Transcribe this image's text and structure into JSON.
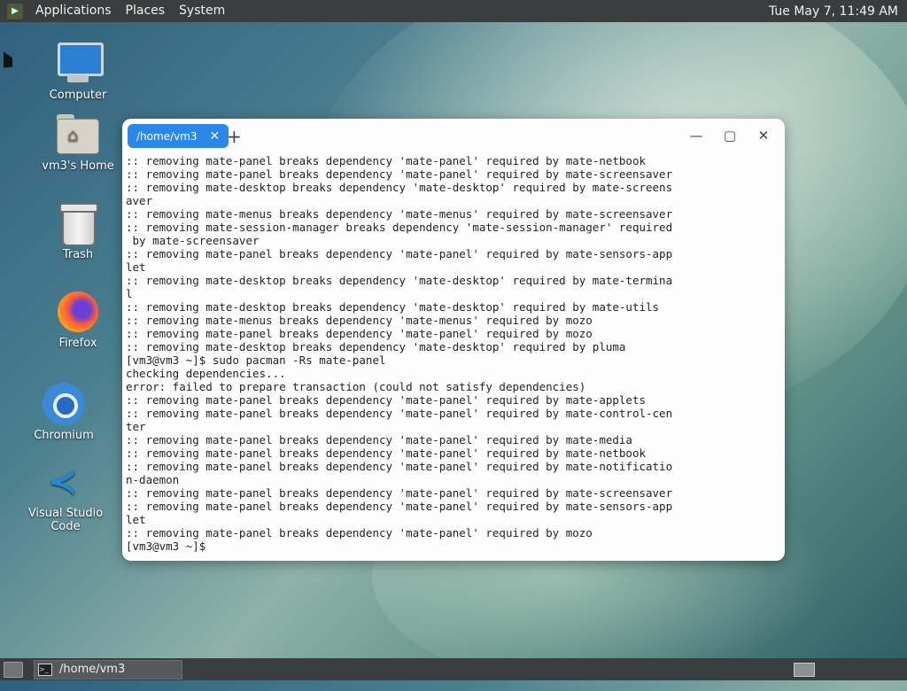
{
  "top_panel": {
    "menus": [
      "Applications",
      "Places",
      "System"
    ],
    "clock": "Tue May 7, 11:49 AM"
  },
  "desktop_icons": [
    {
      "label": "Computer",
      "icon": "computer-icon"
    },
    {
      "label": "vm3's Home",
      "icon": "home-folder-icon"
    },
    {
      "label": "Trash",
      "icon": "trash-icon"
    },
    {
      "label": "Firefox",
      "icon": "firefox-icon"
    },
    {
      "label": "Chromium",
      "icon": "chromium-icon"
    },
    {
      "label": "Visual Studio Code",
      "icon": "vscode-icon"
    }
  ],
  "terminal": {
    "tab_title": "/home/vm3",
    "lines": [
      ":: removing mate-panel breaks dependency 'mate-panel' required by mate-netbook",
      ":: removing mate-panel breaks dependency 'mate-panel' required by mate-screensaver",
      ":: removing mate-desktop breaks dependency 'mate-desktop' required by mate-screens",
      "aver",
      ":: removing mate-menus breaks dependency 'mate-menus' required by mate-screensaver",
      ":: removing mate-session-manager breaks dependency 'mate-session-manager' required",
      " by mate-screensaver",
      ":: removing mate-panel breaks dependency 'mate-panel' required by mate-sensors-app",
      "let",
      ":: removing mate-desktop breaks dependency 'mate-desktop' required by mate-termina",
      "l",
      ":: removing mate-desktop breaks dependency 'mate-desktop' required by mate-utils",
      ":: removing mate-menus breaks dependency 'mate-menus' required by mozo",
      ":: removing mate-panel breaks dependency 'mate-panel' required by mozo",
      ":: removing mate-desktop breaks dependency 'mate-desktop' required by pluma",
      "[vm3@vm3 ~]$ sudo pacman -Rs mate-panel",
      "checking dependencies...",
      "error: failed to prepare transaction (could not satisfy dependencies)",
      ":: removing mate-panel breaks dependency 'mate-panel' required by mate-applets",
      ":: removing mate-panel breaks dependency 'mate-panel' required by mate-control-cen",
      "ter",
      ":: removing mate-panel breaks dependency 'mate-panel' required by mate-media",
      ":: removing mate-panel breaks dependency 'mate-panel' required by mate-netbook",
      ":: removing mate-panel breaks dependency 'mate-panel' required by mate-notificatio",
      "n-daemon",
      ":: removing mate-panel breaks dependency 'mate-panel' required by mate-screensaver",
      ":: removing mate-panel breaks dependency 'mate-panel' required by mate-sensors-app",
      "let",
      ":: removing mate-panel breaks dependency 'mate-panel' required by mozo",
      "[vm3@vm3 ~]$"
    ]
  },
  "taskbar": {
    "window_title": "/home/vm3"
  }
}
